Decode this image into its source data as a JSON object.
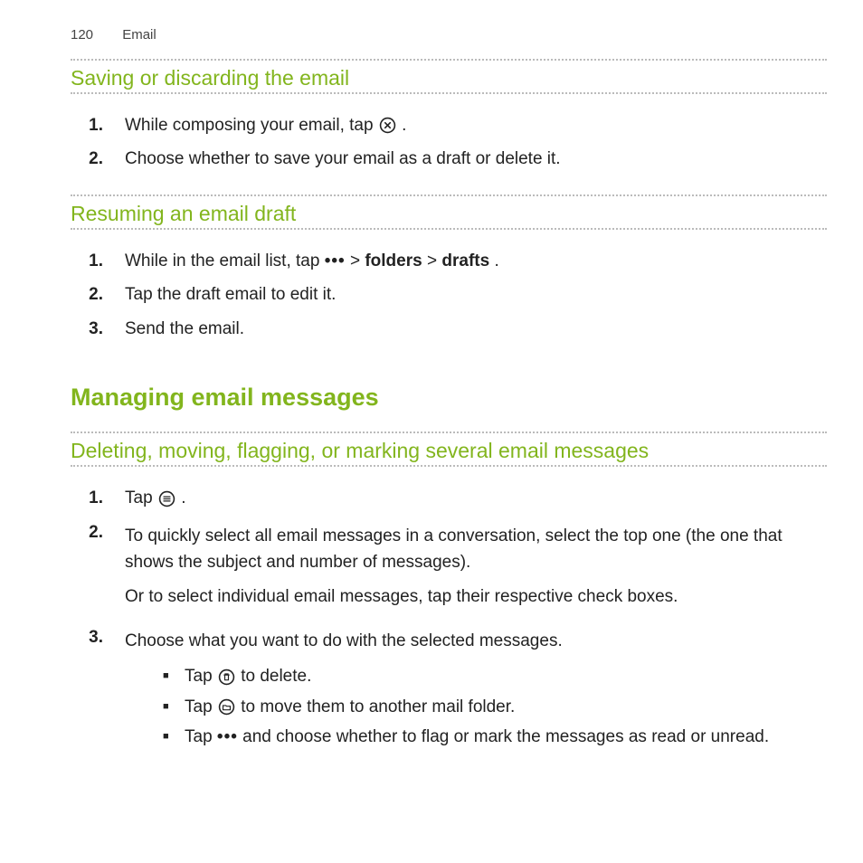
{
  "header": {
    "page_number": "120",
    "section": "Email"
  },
  "sections": {
    "saving": {
      "title": "Saving or discarding the email",
      "steps": [
        {
          "num": "1.",
          "pre": "While composing your email, tap ",
          "post": "."
        },
        {
          "num": "2.",
          "text": "Choose whether to save your email as a draft or delete it."
        }
      ]
    },
    "resuming": {
      "title": "Resuming an email draft",
      "steps": [
        {
          "num": "1.",
          "pre": "While in the email list, tap ",
          "folders": "folders",
          "drafts": "drafts",
          "post": "."
        },
        {
          "num": "2.",
          "text": "Tap the draft email to edit it."
        },
        {
          "num": "3.",
          "text": "Send the email."
        }
      ]
    },
    "managing": {
      "title": "Managing email messages",
      "deleting": {
        "title": "Deleting, moving, flagging, or marking several email messages",
        "steps": [
          {
            "num": "1.",
            "pre": "Tap ",
            "post": "."
          },
          {
            "num": "2.",
            "line1": "To quickly select all email messages in a conversation, select the top one (the one that shows the subject and number of messages).",
            "line2": "Or to select individual email messages, tap their respective check boxes."
          },
          {
            "num": "3.",
            "text": "Choose what you want to do with the selected messages.",
            "bullets": [
              {
                "pre": "Tap ",
                "post": " to delete."
              },
              {
                "pre": "Tap ",
                "post": " to move them to another mail folder."
              },
              {
                "pre": "Tap ",
                "post": " and choose whether to flag or mark the messages as read or unread."
              }
            ]
          }
        ]
      }
    }
  },
  "glyphs": {
    "more": "•••",
    "arrow": ">",
    "bullet": "■"
  }
}
